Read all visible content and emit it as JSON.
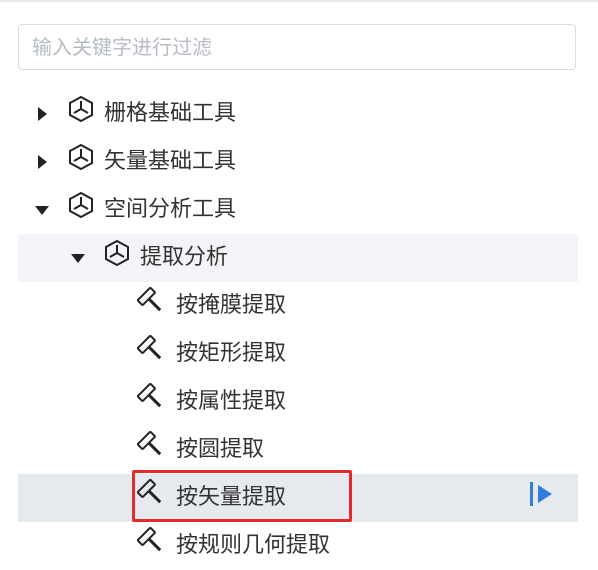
{
  "search": {
    "placeholder": "输入关键字进行过滤",
    "value": ""
  },
  "tree": {
    "nodes": [
      {
        "label": "栅格基础工具",
        "type": "toolbox",
        "expanded": false
      },
      {
        "label": "矢量基础工具",
        "type": "toolbox",
        "expanded": false
      },
      {
        "label": "空间分析工具",
        "type": "toolbox",
        "expanded": true
      },
      {
        "label": "提取分析",
        "type": "toolset",
        "expanded": true
      },
      {
        "label": "按掩膜提取",
        "type": "tool"
      },
      {
        "label": "按矩形提取",
        "type": "tool"
      },
      {
        "label": "按属性提取",
        "type": "tool"
      },
      {
        "label": "按圆提取",
        "type": "tool"
      },
      {
        "label": "按矢量提取",
        "type": "tool",
        "selected": true
      },
      {
        "label": "按规则几何提取",
        "type": "tool"
      }
    ]
  },
  "icons": {
    "toolbox": "hexagon-cube-icon",
    "tool": "hammer-icon",
    "collapsed": "caret-right-icon",
    "expanded": "caret-down-icon",
    "run": "run-tool-icon"
  },
  "colors": {
    "selection_outline": "#e32b2b",
    "run_button": "#2f7de1",
    "selected_row_bg": "#e6eaef",
    "expanded_row_bg": "#f2f4f7"
  }
}
